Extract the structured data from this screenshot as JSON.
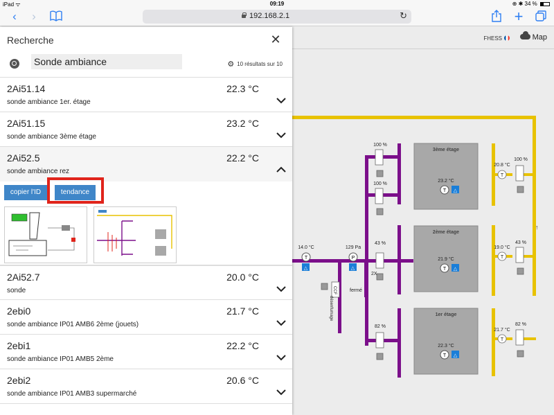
{
  "status_bar": {
    "device": "iPad",
    "time": "09:19",
    "battery": "34 %",
    "battery_level": 0.34
  },
  "browser": {
    "url": "192.168.2.1"
  },
  "search": {
    "title": "Recherche",
    "query": "Sonde ambiance",
    "results_count": "10 résultats sur 10"
  },
  "results": [
    {
      "id": "2Ai51.14",
      "value": "22.3 °C",
      "desc": "sonde ambiance 1er. étage"
    },
    {
      "id": "2Ai51.15",
      "value": "23.2 °C",
      "desc": "sonde ambiance 3ème étage"
    },
    {
      "id": "2Ai52.5",
      "value": "22.2 °C",
      "desc": "sonde ambiance rez"
    },
    {
      "id": "2Ai52.7",
      "value": "20.0 °C",
      "desc": "sonde"
    },
    {
      "id": "2ebi0",
      "value": "21.7 °C",
      "desc": "sonde ambiance IP01 AMB6 2ème (jouets)"
    },
    {
      "id": "2ebi1",
      "value": "22.2 °C",
      "desc": "sonde ambiance IP01 AMB5 2ème"
    },
    {
      "id": "2ebi2",
      "value": "20.6 °C",
      "desc": "sonde ambiance IP01 AMB3 supermarché"
    }
  ],
  "expanded_actions": {
    "copy_label": "copier l'ID",
    "trend_label": "tendance"
  },
  "synoptic": {
    "user": "FHESS",
    "map_label": "Map",
    "floors": [
      {
        "name": "3ème étage",
        "temp": "23.2 °C",
        "supply_pct": "100 %",
        "exhaust_pct": "100 %",
        "exhaust_temp": "20.8 °C",
        "return_pct": "100 %"
      },
      {
        "name": "2ème étage",
        "temp": "21.9 °C",
        "supply_pct": "43 %",
        "exhaust_pct": "43 %",
        "exhaust_temp": "19.0 °C"
      },
      {
        "name": "1er étage",
        "temp": "22.3 °C",
        "supply_pct": "82 %",
        "exhaust_pct": "82 %",
        "exhaust_temp": "21.7 °C"
      }
    ],
    "outside_temp": "14.0 °C",
    "pressure": "129 Pa",
    "multiplier": "2X",
    "damper_label": "CCF",
    "damper_state": "fermé",
    "smoke_label": "désenfumage",
    "sensor_letter": "T",
    "pressure_letter": "P"
  },
  "colors": {
    "supply": "#7b0f8a",
    "exhaust": "#e8c200",
    "accent": "#3f86c8",
    "highlight": "#e0241b",
    "alarm": "#1a7ed8"
  }
}
